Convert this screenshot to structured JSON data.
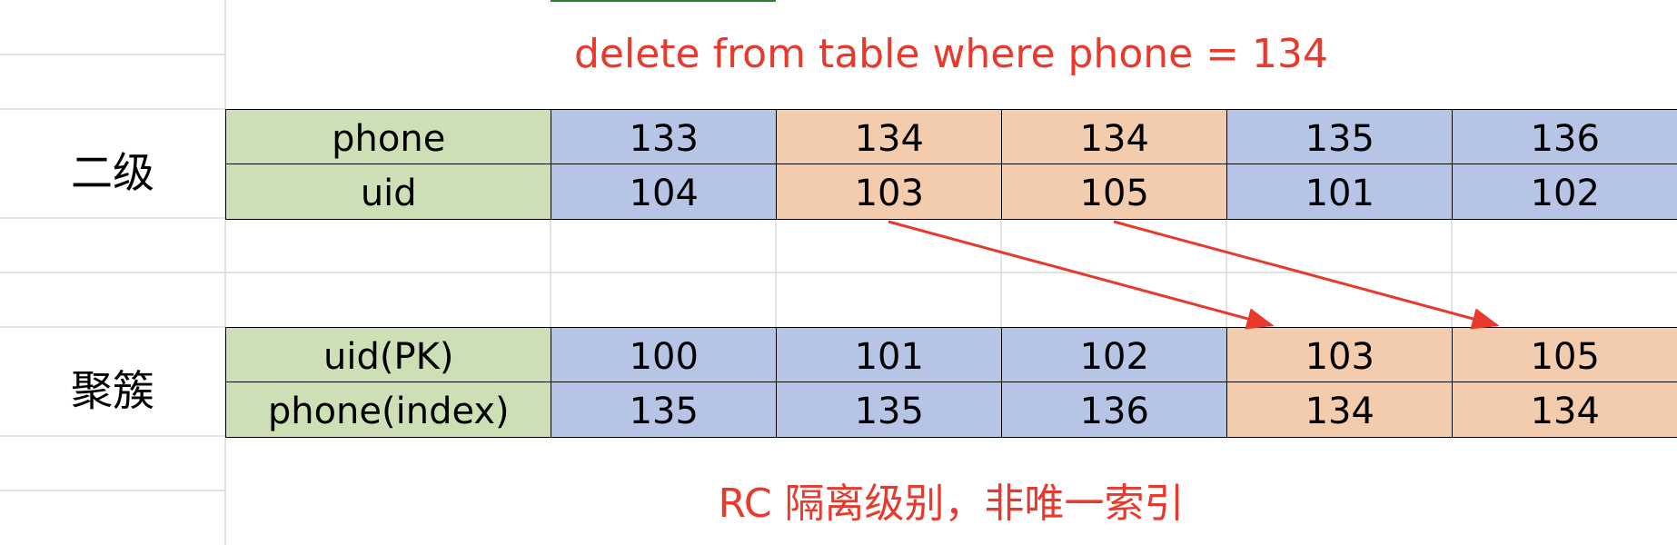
{
  "query_text": "delete from table where phone = 134",
  "note_text": "RC 隔离级别，非唯一索引",
  "secondary_index": {
    "label": "二级",
    "rows": [
      {
        "header": "phone",
        "values": [
          "133",
          "134",
          "134",
          "135",
          "136"
        ]
      },
      {
        "header": "uid",
        "values": [
          "104",
          "103",
          "105",
          "101",
          "102"
        ]
      }
    ],
    "highlight": [
      false,
      true,
      true,
      false,
      false
    ]
  },
  "clustered_index": {
    "label": "聚簇",
    "rows": [
      {
        "header": "uid(PK)",
        "values": [
          "100",
          "101",
          "102",
          "103",
          "105"
        ]
      },
      {
        "header": "phone(index)",
        "values": [
          "135",
          "135",
          "136",
          "134",
          "134"
        ]
      }
    ],
    "highlight": [
      false,
      false,
      false,
      true,
      true
    ]
  },
  "arrows": [
    {
      "from": "secondary uid 103",
      "to": "clustered uid 103"
    },
    {
      "from": "secondary uid 105",
      "to": "clustered uid 105"
    }
  ],
  "colors": {
    "header": "#cde0b5",
    "normal": "#b6c5e6",
    "highlight": "#f3cbad",
    "annotation": "#e8392c",
    "gridline": "#d9d9d9"
  }
}
